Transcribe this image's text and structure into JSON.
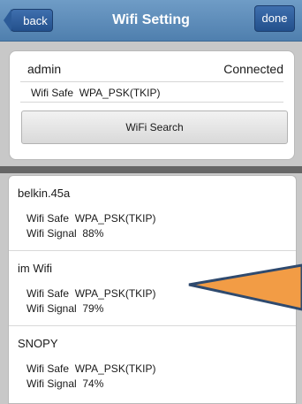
{
  "header": {
    "title": "Wifi Setting",
    "back_label": "back",
    "done_label": "done"
  },
  "connected": {
    "ssid": "admin",
    "status": "Connected",
    "safe_label": "Wifi Safe",
    "safe_value": "WPA_PSK(TKIP)"
  },
  "search_button": "WiFi Search",
  "networks": [
    {
      "ssid": "belkin.45a",
      "safe_label": "Wifi Safe",
      "safe_value": "WPA_PSK(TKIP)",
      "signal_label": "Wifi Signal",
      "signal_value": "88%"
    },
    {
      "ssid": "im Wifi",
      "safe_label": "Wifi Safe",
      "safe_value": "WPA_PSK(TKIP)",
      "signal_label": "Wifi Signal",
      "signal_value": "79%"
    },
    {
      "ssid": "SNOPY",
      "safe_label": "Wifi Safe",
      "safe_value": "WPA_PSK(TKIP)",
      "signal_label": "Wifi Signal",
      "signal_value": "74%"
    }
  ],
  "colors": {
    "header": "#5b8bba",
    "button": "#2c5b98",
    "pointer": "#f29c45"
  }
}
